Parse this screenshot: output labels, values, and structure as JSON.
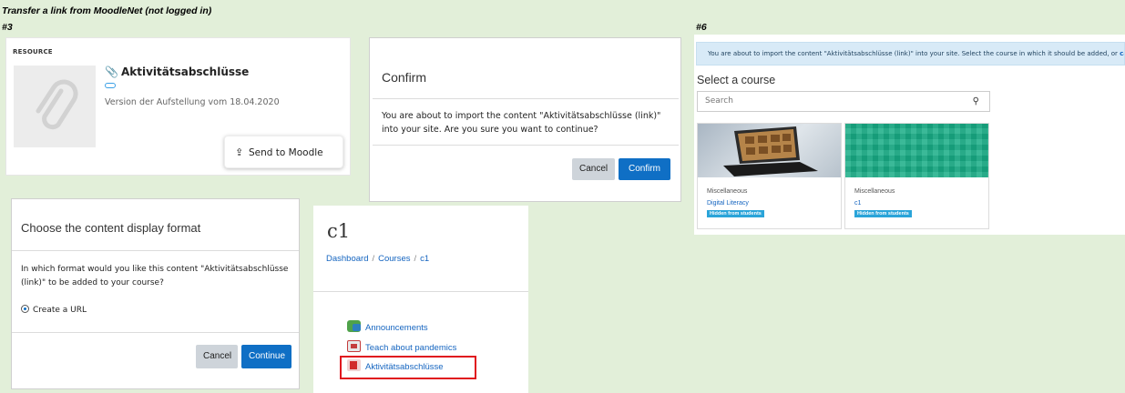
{
  "captions": {
    "main": "Transfer a link from MoodleNet (not logged in)",
    "step3": "#3",
    "step6": "#6"
  },
  "resource": {
    "kicker": "RESOURCE",
    "title": "Aktivitätsabschlüsse",
    "version": "Version der Aufstellung vom 18.04.2020",
    "send_button": "Send to Moodle"
  },
  "confirm": {
    "title": "Confirm",
    "body": "You are about to import the content \"Aktivitätsabschlüsse (link)\" into your site. Are you sure you want to continue?",
    "cancel_label": "Cancel",
    "confirm_label": "Confirm"
  },
  "select_course": {
    "alert_text": "You are about to import the content \"Aktivitätsabschlüsse (link)\" into your site. Select the course in which it should be added, or",
    "alert_cancel": "cancel",
    "title": "Select a course",
    "search_placeholder": "Search",
    "courses": [
      {
        "category": "Miscellaneous",
        "name": "Digital Literacy",
        "badge": "Hidden from students"
      },
      {
        "category": "Miscellaneous",
        "name": "c1",
        "badge": "Hidden from students"
      }
    ]
  },
  "format_dialog": {
    "title": "Choose the content display format",
    "question": "In which format would you like this content \"Aktivitätsabschlüsse (link)\" to be added to your course?",
    "option_label": "Create a URL",
    "cancel_label": "Cancel",
    "continue_label": "Continue"
  },
  "course_page": {
    "title": "c1",
    "breadcrumb": [
      "Dashboard",
      "Courses",
      "c1"
    ],
    "activities": [
      {
        "label": "Announcements",
        "icon": "forum-icon"
      },
      {
        "label": "Teach about pandemics",
        "icon": "resource-icon"
      },
      {
        "label": "Aktivitätsabschlüsse",
        "icon": "url-icon",
        "highlighted": true
      }
    ]
  },
  "colors": {
    "background": "#e2efd9",
    "primary": "#0f6fc5",
    "highlight": "#e0151e",
    "badge": "#2aa4d9"
  }
}
